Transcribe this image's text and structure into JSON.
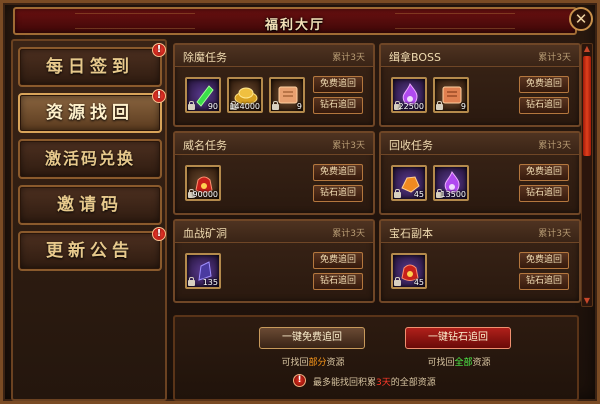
{
  "window": {
    "title": "福利大厅",
    "close_label": "✕"
  },
  "nav": {
    "items": [
      {
        "label": "每日签到",
        "badge": "!"
      },
      {
        "label": "资源找回",
        "badge": "!",
        "active": true
      },
      {
        "label": "激活码兑换",
        "badge": ""
      },
      {
        "label": "邀请码",
        "badge": ""
      },
      {
        "label": "更新公告",
        "badge": "!"
      }
    ]
  },
  "cards": [
    {
      "title": "除魔任务",
      "limit": "累计3天",
      "free_btn": "免费追回",
      "diamond_btn": "钻石追回",
      "items": [
        {
          "icon": "green-gem-icon",
          "qty": "90"
        },
        {
          "icon": "gold-ingot-icon",
          "qty": "144000"
        },
        {
          "icon": "scroll-icon",
          "qty": "9"
        }
      ]
    },
    {
      "title": "缉拿BOSS",
      "limit": "累计3天",
      "free_btn": "免费追回",
      "diamond_btn": "钻石追回",
      "items": [
        {
          "icon": "purple-flame-icon",
          "qty": "22500"
        },
        {
          "icon": "scroll-icon",
          "qty": "9"
        }
      ]
    },
    {
      "title": "威名任务",
      "limit": "累计3天",
      "free_btn": "免费追回",
      "diamond_btn": "钻石追回",
      "items": [
        {
          "icon": "red-pouch-icon",
          "qty": "90000"
        }
      ]
    },
    {
      "title": "回收任务",
      "limit": "累计3天",
      "free_btn": "免费追回",
      "diamond_btn": "钻石追回",
      "items": [
        {
          "icon": "orange-ore-icon",
          "qty": "45"
        },
        {
          "icon": "purple-flame-icon",
          "qty": "13500"
        }
      ]
    },
    {
      "title": "血战矿洞",
      "limit": "累计3天",
      "free_btn": "免费追回",
      "diamond_btn": "钻石追回",
      "items": [
        {
          "icon": "dark-crystal-icon",
          "qty": "135"
        }
      ]
    },
    {
      "title": "宝石副本",
      "limit": "累计3天",
      "free_btn": "免费追回",
      "diamond_btn": "钻石追回",
      "items": [
        {
          "icon": "red-pouch-icon",
          "qty": "45"
        }
      ]
    }
  ],
  "bottom": {
    "free_all_btn": "一键免费追回",
    "diamond_all_btn": "一键钻石追回",
    "free_note_pre": "可找回",
    "free_note_hl": "部分",
    "free_note_post": "资源",
    "diamond_note_pre": "可找回",
    "diamond_note_hl": "全部",
    "diamond_note_post": "资源",
    "tip_icon": "!",
    "tip_pre": "最多能找回积累",
    "tip_hl": "3天",
    "tip_post": "的全部资源"
  },
  "colors": {
    "accent_gold": "#c8904a",
    "title_red": "#6a1010",
    "highlight_orange": "#ff9a1a",
    "highlight_green": "#4ef04a",
    "highlight_red": "#ff3a2a"
  }
}
